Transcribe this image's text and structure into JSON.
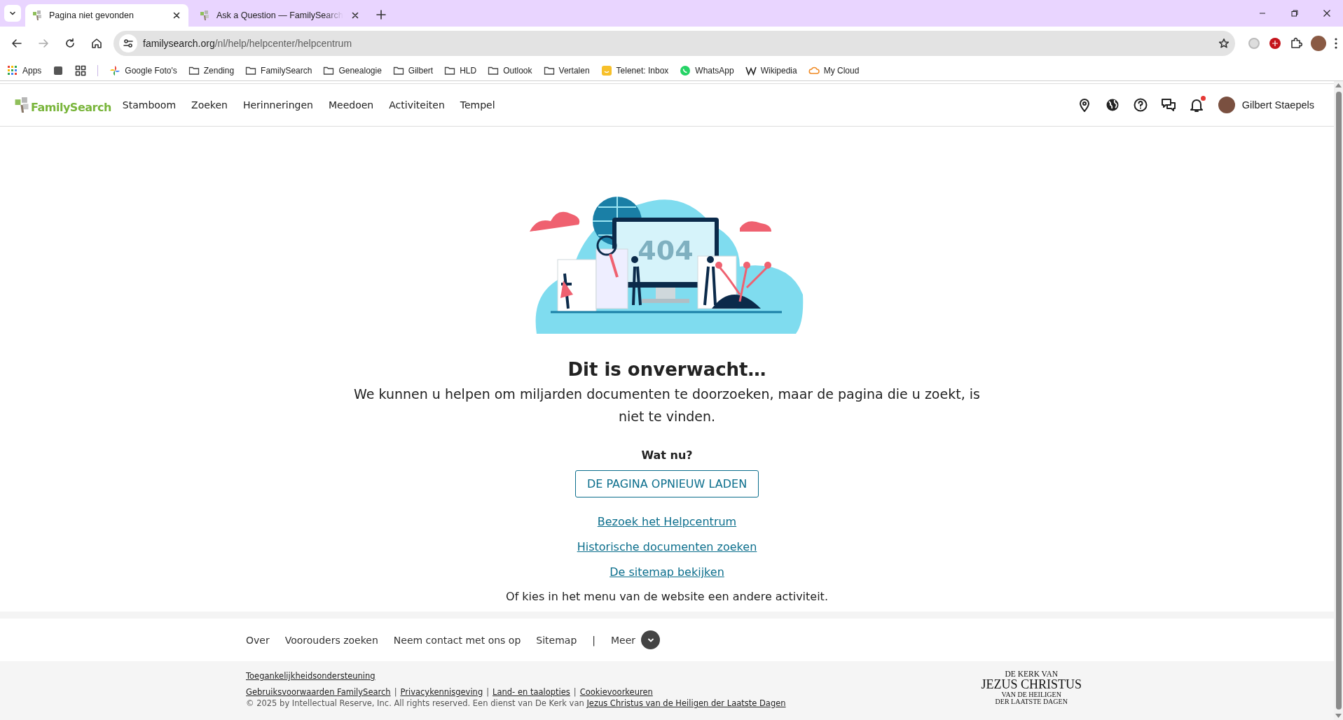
{
  "browser": {
    "tabs": [
      {
        "title": "Pagina niet gevonden",
        "selected": true
      },
      {
        "title": "Ask a Question — FamilySearch",
        "selected": false
      }
    ],
    "address": {
      "domain": "familysearch.org",
      "path": "/nl/help/helpcenter/helpcentrum"
    },
    "bookmarks": [
      {
        "kind": "apps",
        "label": "Apps"
      },
      {
        "kind": "square"
      },
      {
        "kind": "grid"
      },
      {
        "kind": "photos",
        "label": "Google Foto's"
      },
      {
        "kind": "folder",
        "label": "Zending"
      },
      {
        "kind": "folder",
        "label": "FamilySearch"
      },
      {
        "kind": "folder",
        "label": "Genealogie"
      },
      {
        "kind": "folder",
        "label": "Gilbert"
      },
      {
        "kind": "folder",
        "label": "HLD"
      },
      {
        "kind": "folder",
        "label": "Outlook"
      },
      {
        "kind": "folder",
        "label": "Vertalen"
      },
      {
        "kind": "smiley",
        "label": "Telenet: Inbox"
      },
      {
        "kind": "whatsapp",
        "label": "WhatsApp"
      },
      {
        "kind": "wiki",
        "label": "Wikipedia"
      },
      {
        "kind": "cloud",
        "label": "My Cloud"
      }
    ]
  },
  "header": {
    "logo": "FamilySearch",
    "nav": [
      "Stamboom",
      "Zoeken",
      "Herinneringen",
      "Meedoen",
      "Activiteiten",
      "Tempel"
    ],
    "notifications_unread": true,
    "user": "Gilbert Staepels"
  },
  "main": {
    "illustration_text": "404",
    "title": "Dit is onverwacht…",
    "message": "We kunnen u helpen om miljarden documenten te doorzoeken, maar de pagina die u zoekt, is niet te vinden.",
    "subtitle": "Wat nu?",
    "button": "DE PAGINA OPNIEUW LADEN",
    "links": [
      "Bezoek het Helpcentrum",
      "Historische documenten zoeken",
      "De sitemap bekijken"
    ],
    "note": "Of kies in het menu van de website een andere activiteit."
  },
  "footer": {
    "links": [
      "Over",
      "Voorouders zoeken",
      "Neem contact met ons op",
      "Sitemap"
    ],
    "separator": "|",
    "more": "Meer",
    "accessibility": "Toegankelijkheidsondersteuning",
    "legal_links": [
      "Gebruiksvoorwaarden FamilySearch",
      "Privacykennisgeving",
      "Land- en taalopties",
      "Cookievoorkeuren"
    ],
    "legal_separator": "|",
    "copyright": "© 2025 by Intellectual Reserve, Inc. All rights reserved. Een dienst van De Kerk van ",
    "copyright_link": "Jezus Christus van de Heiligen der Laatste Dagen",
    "church_logo": [
      "DE KERK VAN",
      "JEZUS CHRISTUS",
      "VAN DE HEILIGEN",
      "DER LAATSTE DAGEN"
    ]
  }
}
